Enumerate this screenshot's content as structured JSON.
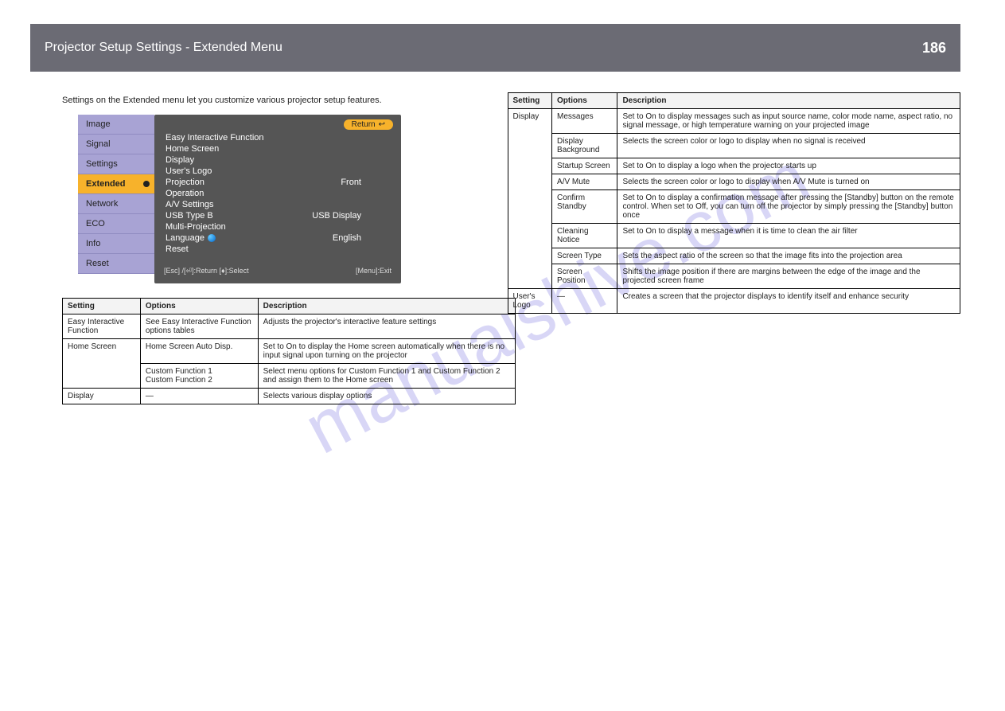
{
  "header": {
    "title": "Projector Setup Settings - Extended Menu",
    "page": "186"
  },
  "watermark": "manualshive.com",
  "intro": "Settings on the Extended menu let you customize various projector setup features.",
  "osd": {
    "tabs": [
      "Image",
      "Signal",
      "Settings",
      "Extended",
      "Network",
      "ECO",
      "Info",
      "Reset"
    ],
    "selected": "Extended",
    "return": "Return",
    "items": [
      {
        "l": "Easy Interactive Function",
        "r": ""
      },
      {
        "l": "Home Screen",
        "r": ""
      },
      {
        "l": "Display",
        "r": ""
      },
      {
        "l": "User's Logo",
        "r": ""
      },
      {
        "l": "Projection",
        "r": "Front"
      },
      {
        "l": "Operation",
        "r": ""
      },
      {
        "l": "A/V Settings",
        "r": ""
      },
      {
        "l": "USB Type B",
        "r": "USB Display"
      },
      {
        "l": "Multi-Projection",
        "r": ""
      },
      {
        "l": "Language",
        "r": "English",
        "globe": true
      },
      {
        "l": "Reset",
        "r": ""
      }
    ],
    "bottom_left": "[Esc] /[⏎]:Return  [♦]:Select",
    "bottom_right": "[Menu]:Exit"
  },
  "table1": {
    "head": [
      "Setting",
      "Options",
      "Description"
    ],
    "rows": [
      {
        "s": "Easy Interactive Function",
        "o": "See Easy Interactive Function options tables",
        "d": "Adjusts the projector's interactive feature settings"
      },
      {
        "s": "Home Screen",
        "o": "Home Screen Auto Disp.",
        "d": "Set to On to display the Home screen automatically when there is no input signal upon turning on the projector",
        "rowspan": 3,
        "merge": true
      },
      {
        "s": "",
        "o": "Custom Function 1\nCustom Function 2",
        "d": "Select menu options for Custom Function 1 and Custom Function 2 and assign them to the Home screen"
      }
    ],
    "last": {
      "s": "Display",
      "o": "—",
      "d": "Selects various display options"
    }
  },
  "table2": {
    "head": [
      "Setting",
      "Options",
      "Description"
    ],
    "rows": [
      {
        "s": "Display",
        "rowspan": 9,
        "cells": [
          {
            "o": "Messages",
            "d": "Set to On to display messages such as input source name, color mode name, aspect ratio, no signal message, or high temperature warning on your projected image"
          },
          {
            "o": "Display Background",
            "d": "Selects the screen color or logo to display when no signal is received"
          },
          {
            "o": "Startup Screen",
            "d": "Set to On to display a logo when the projector starts up"
          },
          {
            "o": "A/V Mute",
            "d": "Selects the screen color or logo to display when A/V Mute is turned on"
          },
          {
            "o": "Confirm Standby",
            "d": "Set to On to display a confirmation message after pressing the [Standby] button on the remote control. When set to Off, you can turn off the projector by simply pressing the [Standby] button once"
          },
          {
            "o": "Cleaning Notice",
            "d": "Set to On to display a message when it is time to clean the air filter"
          },
          {
            "o": "Screen Type",
            "d": "Sets the aspect ratio of the screen so that the image fits into the projection area"
          },
          {
            "o": "Screen Position",
            "d": "Shifts the image position if there are margins between the edge of the image and the projected screen frame"
          }
        ]
      },
      {
        "s": "User's Logo",
        "o": "—",
        "d": "Creates a screen that the projector displays to identify itself and enhance security"
      }
    ]
  }
}
